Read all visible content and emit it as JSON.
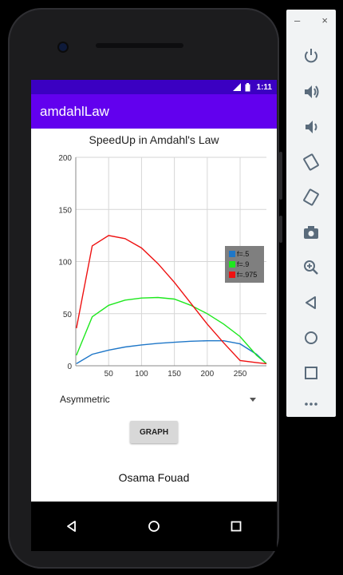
{
  "app": {
    "title": "amdahlLaw"
  },
  "status_bar": {
    "time": "1:11",
    "network": "LTE"
  },
  "chart_data": {
    "type": "line",
    "title": "SpeedUp in Amdahl's Law",
    "x": [
      1,
      25,
      50,
      75,
      100,
      125,
      150,
      175,
      200,
      225,
      250,
      275,
      290
    ],
    "xticks": [
      50,
      100,
      150,
      200,
      250
    ],
    "yticks": [
      0,
      50,
      100,
      150,
      200
    ],
    "xlim": [
      0,
      290
    ],
    "ylim": [
      0,
      200
    ],
    "grid": true,
    "legend_position": "right",
    "series": [
      {
        "name": "f=.5",
        "color": "#1f77c8",
        "values": [
          2,
          11,
          15,
          18,
          20,
          21.5,
          22.5,
          23.5,
          24,
          24,
          21,
          11,
          2
        ]
      },
      {
        "name": "f=.9",
        "color": "#1ee81e",
        "values": [
          10,
          47,
          58,
          63,
          65,
          65.5,
          64,
          58,
          50,
          40,
          28,
          10,
          2
        ]
      },
      {
        "name": "f=.975",
        "color": "#ee1111",
        "values": [
          36,
          115,
          125,
          122,
          113,
          98,
          80,
          60,
          40,
          22,
          5,
          3,
          2
        ]
      }
    ]
  },
  "spinner": {
    "selected": "Asymmetric"
  },
  "graph_button": {
    "label": "GRAPH"
  },
  "author": {
    "name": "Osama Fouad"
  },
  "nav": {
    "back": "back-icon",
    "home": "home-icon",
    "recents": "recents-icon"
  },
  "emulator_panel": {
    "minimize": "–",
    "close": "×",
    "buttons": [
      "power-icon",
      "volume-up-icon",
      "volume-down-icon",
      "rotate-left-icon",
      "rotate-right-icon",
      "camera-icon",
      "zoom-icon",
      "back-icon",
      "home-icon",
      "overview-icon",
      "more-icon"
    ]
  }
}
